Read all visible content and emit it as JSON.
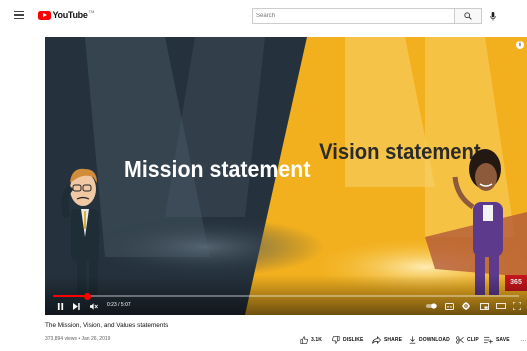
{
  "header": {
    "logo_text": "YouTube",
    "logo_sup": "TM",
    "search_placeholder": "Search"
  },
  "video": {
    "left_slide_text": "Mission statement",
    "right_slide_text": "Vision statement",
    "time_display": "0:23 / 5:07",
    "progress_fraction": 0.075,
    "corner_badge": "365",
    "colors": {
      "left_bg": "#25323d",
      "right_bg": "#f2b01f",
      "progress": "#ff0000"
    }
  },
  "details": {
    "title": "The Mission, Vision, and Values statements",
    "meta": "373,894 views • Jan 26, 2019"
  },
  "actions": {
    "like_count": "3.1K",
    "dislike_label": "DISLIKE",
    "share_label": "SHARE",
    "download_label": "DOWNLOAD",
    "clip_label": "CLIP",
    "save_label": "SAVE",
    "more_label": "…"
  }
}
